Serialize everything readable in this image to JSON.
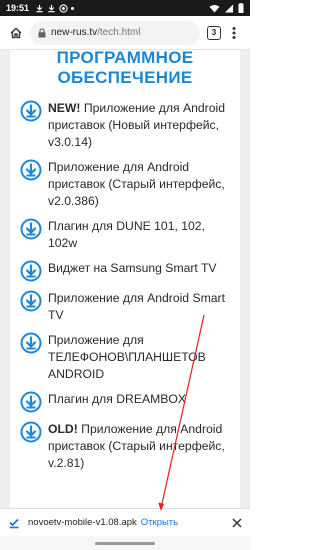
{
  "status_bar": {
    "time": "19:51"
  },
  "browser": {
    "url_domain": "new-rus.tv",
    "url_path": "/tech.html",
    "tab_count": "3"
  },
  "page": {
    "title_line1": "ПРОГРАММНОЕ",
    "title_line2": "ОБЕСПЕЧЕНИЕ",
    "items": [
      {
        "bold": "NEW!",
        "text": " Приложение для Android приставок (Новый интерфейс, v3.0.14)"
      },
      {
        "bold": "",
        "text": "Приложение для Android приставок (Старый интерфейс, v2.0.386)"
      },
      {
        "bold": "",
        "text": "Плагин для DUNE 101, 102, 102w"
      },
      {
        "bold": "",
        "text": "Виджет на Samsung Smart TV"
      },
      {
        "bold": "",
        "text": "Приложение для Android Smart TV"
      },
      {
        "bold": "",
        "text": "Приложение для ТЕЛЕФОНОВ\\ПЛАНШЕТОВ ANDROID"
      },
      {
        "bold": "",
        "text": "Плагин для DREAMBOX"
      },
      {
        "bold": "OLD!",
        "text": " Приложение для Android приставок (Старый интерфейс, v.2.81)"
      }
    ]
  },
  "download": {
    "filename": "novoetv-mobile-v1.08.apk",
    "open_label": "Открыть"
  },
  "colors": {
    "accent_blue": "#1a87d8",
    "link_blue": "#1a73e8",
    "arrow_red": "#e8201c"
  },
  "icons": {
    "download_item": "download-circle-icon",
    "download_done": "download-done-icon"
  }
}
